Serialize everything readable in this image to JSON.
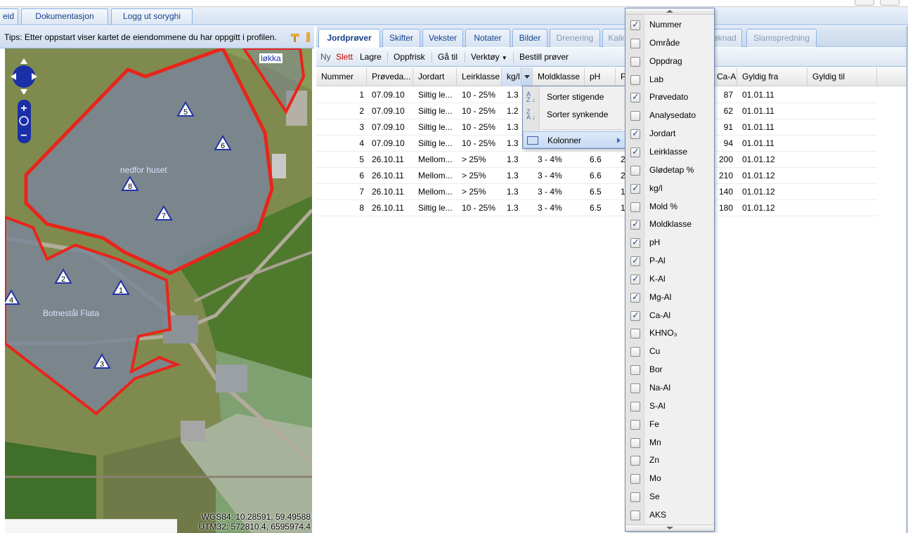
{
  "top_tabs": [
    {
      "label": "eid"
    },
    {
      "label": "Dokumentasjon"
    },
    {
      "label": "Logg ut soryghi"
    }
  ],
  "tip_text": "Tips: Etter oppstart viser kartet de eiendommene du har oppgitt i profilen.",
  "map": {
    "labels": {
      "lokka": "løkka",
      "field1": "nedfor huset",
      "field2": "Botnestål Flata"
    },
    "points": [
      "1",
      "2",
      "3",
      "4",
      "5",
      "6",
      "7",
      "8"
    ],
    "coords_wgs": "WGS84: 10.28591, 59.49588",
    "coords_utm": "UTM32: 572810.4, 6595974.4",
    "colors": {
      "field_outline": "#e8251b",
      "field_fill": "#7a8598",
      "point": "#2233aa"
    }
  },
  "panel_tabs": [
    {
      "label": "Jordprøver",
      "state": "active"
    },
    {
      "label": "Skifter",
      "state": "normal"
    },
    {
      "label": "Vekster",
      "state": "normal"
    },
    {
      "label": "Notater",
      "state": "normal"
    },
    {
      "label": "Bilder",
      "state": "normal"
    },
    {
      "label": "Drenering",
      "state": "disabled"
    },
    {
      "label": "Kalk",
      "state": "disabled"
    },
    {
      "label": "øknad",
      "state": "disabled"
    },
    {
      "label": "Slamspredning",
      "state": "disabled"
    }
  ],
  "toolbar": {
    "ny": "Ny",
    "slett": "Slett",
    "lagre": "Lagre",
    "oppfrisk": "Oppfrisk",
    "ga_til": "Gå til",
    "verktoy": "Verktøy",
    "bestill": "Bestill prøver"
  },
  "grid": {
    "columns": [
      "Nummer",
      "Prøveda...",
      "Jordart",
      "Leirklasse",
      "kg/l",
      "Moldklasse",
      "pH",
      "P",
      "Ca-Al",
      "Gyldig fra",
      "Gyldig til"
    ],
    "rows": [
      {
        "nummer": "1",
        "dato": "07.09.10",
        "jordart": "Siltig le...",
        "leir": "10 - 25%",
        "kgl": "1.3",
        "mold": "",
        "ph": "",
        "p": "",
        "ca": "87",
        "fra": "01.01.11",
        "til": ""
      },
      {
        "nummer": "2",
        "dato": "07.09.10",
        "jordart": "Siltig le...",
        "leir": "10 - 25%",
        "kgl": "1.2",
        "mold": "",
        "ph": "",
        "p": "",
        "ca": "62",
        "fra": "01.01.11",
        "til": ""
      },
      {
        "nummer": "3",
        "dato": "07.09.10",
        "jordart": "Siltig le...",
        "leir": "10 - 25%",
        "kgl": "1.3",
        "mold": "",
        "ph": "",
        "p": "",
        "ca": "91",
        "fra": "01.01.11",
        "til": ""
      },
      {
        "nummer": "4",
        "dato": "07.09.10",
        "jordart": "Siltig le...",
        "leir": "10 - 25%",
        "kgl": "1.3",
        "mold": "",
        "ph": "",
        "p": "",
        "ca": "94",
        "fra": "01.01.11",
        "til": ""
      },
      {
        "nummer": "5",
        "dato": "26.10.11",
        "jordart": "Mellom...",
        "leir": "> 25%",
        "kgl": "1.3",
        "mold": "3 - 4%",
        "ph": "6.6",
        "p": "2",
        "ca": "200",
        "fra": "01.01.12",
        "til": ""
      },
      {
        "nummer": "6",
        "dato": "26.10.11",
        "jordart": "Mellom...",
        "leir": "> 25%",
        "kgl": "1.3",
        "mold": "3 - 4%",
        "ph": "6.6",
        "p": "2",
        "ca": "210",
        "fra": "01.01.12",
        "til": ""
      },
      {
        "nummer": "7",
        "dato": "26.10.11",
        "jordart": "Mellom...",
        "leir": "> 25%",
        "kgl": "1.3",
        "mold": "3 - 4%",
        "ph": "6.5",
        "p": "1",
        "ca": "140",
        "fra": "01.01.12",
        "til": ""
      },
      {
        "nummer": "8",
        "dato": "26.10.11",
        "jordart": "Siltig le...",
        "leir": "10 - 25%",
        "kgl": "1.3",
        "mold": "3 - 4%",
        "ph": "6.5",
        "p": "1",
        "ca": "180",
        "fra": "01.01.12",
        "til": ""
      }
    ]
  },
  "context_menu": {
    "sort_asc": "Sorter stigende",
    "sort_desc": "Sorter synkende",
    "columns": "Kolonner"
  },
  "column_menu": [
    {
      "label": "Nummer",
      "checked": true
    },
    {
      "label": "Område",
      "checked": false
    },
    {
      "label": "Oppdrag",
      "checked": false
    },
    {
      "label": "Lab",
      "checked": false
    },
    {
      "label": "Prøvedato",
      "checked": true
    },
    {
      "label": "Analysedato",
      "checked": false
    },
    {
      "label": "Jordart",
      "checked": true
    },
    {
      "label": "Leirklasse",
      "checked": true
    },
    {
      "label": "Glødetap %",
      "checked": false
    },
    {
      "label": "kg/l",
      "checked": true
    },
    {
      "label": "Mold %",
      "checked": false
    },
    {
      "label": "Moldklasse",
      "checked": true
    },
    {
      "label": "pH",
      "checked": true
    },
    {
      "label": "P-Al",
      "checked": true
    },
    {
      "label": "K-Al",
      "checked": true
    },
    {
      "label": "Mg-Al",
      "checked": true
    },
    {
      "label": "Ca-Al",
      "checked": true
    },
    {
      "label": "KHNO₃",
      "checked": false
    },
    {
      "label": "Cu",
      "checked": false
    },
    {
      "label": "Bor",
      "checked": false
    },
    {
      "label": "Na-Al",
      "checked": false
    },
    {
      "label": "S-Al",
      "checked": false
    },
    {
      "label": "Fe",
      "checked": false
    },
    {
      "label": "Mn",
      "checked": false
    },
    {
      "label": "Zn",
      "checked": false
    },
    {
      "label": "Mo",
      "checked": false
    },
    {
      "label": "Se",
      "checked": false
    },
    {
      "label": "AKS",
      "checked": false
    }
  ]
}
